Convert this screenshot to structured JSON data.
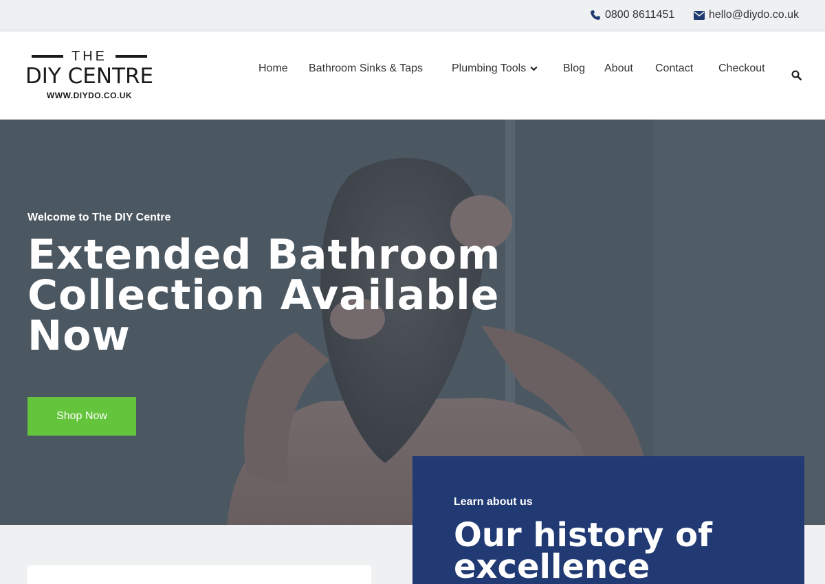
{
  "topbar": {
    "phone": "0800 8611451",
    "email": "hello@diydo.co.uk"
  },
  "logo": {
    "the": "THE",
    "name": "DIY CENTRE",
    "url": "WWW.DIYDO.CO.UK"
  },
  "nav": {
    "home": "Home",
    "sinks": "Bathroom Sinks & Taps",
    "tools": "Plumbing Tools",
    "blog": "Blog",
    "about": "About",
    "contact": "Contact",
    "checkout": "Checkout"
  },
  "hero": {
    "welcome": "Welcome to The DIY Centre",
    "title": "Extended Bathroom Collection Available Now",
    "button": "Shop Now"
  },
  "about_card": {
    "kicker": "Learn about us",
    "title": "Our history of excellence"
  },
  "icons": {
    "phone": "phone-icon",
    "email": "envelope-icon",
    "dropdown": "chevron-down-icon",
    "search": "search-icon"
  },
  "colors": {
    "accent_green": "#64c43b",
    "brand_navy": "#213a73",
    "icon_navy": "#1f3a6e"
  }
}
